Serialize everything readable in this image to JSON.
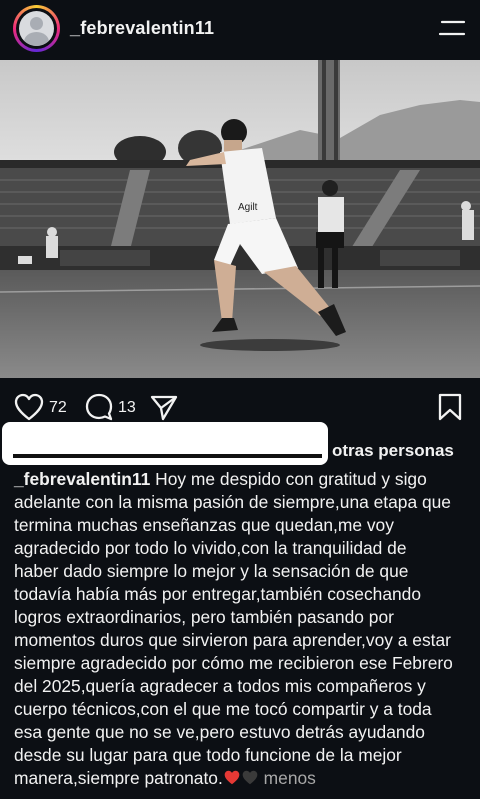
{
  "header": {
    "username": "_febrevalentin11",
    "avatar_icon": "default-avatar-icon",
    "menu_icon": "menu-icon"
  },
  "post": {
    "image_description_colors": {
      "sky": "#b9b9b9",
      "field": "#6e6e6e"
    },
    "player_jersey_text": "Agilt"
  },
  "actions": {
    "like_count": "72",
    "comment_count": "13",
    "icons": [
      "heart-icon",
      "comment-icon",
      "share-icon",
      "bookmark-icon"
    ]
  },
  "liked_by": {
    "others_text": "otras personas"
  },
  "caption": {
    "username": "_febrevalentin11",
    "lines": [
      " Hoy me despido con gratitud y sigo",
      "adelante con la misma pasión de siempre,una etapa que",
      "termina muchas enseñanzas que quedan,me voy",
      "agradecido por todo lo vivido,con la tranquilidad de",
      "haber dado siempre lo mejor y la sensación de que",
      "todavía había más por entregar,también cosechando",
      "logros extraordinarios, pero también pasando por",
      "momentos duros que sirvieron para aprender,voy a estar",
      "siempre agradecido por cómo me recibieron ese Febrero",
      "del 2025,quería agradecer a todos mis compañeros y",
      "cuerpo técnicos,con el que me tocó compartir y a toda",
      "esa gente que no se ve,pero estuvo detrás ayudando",
      "desde su lugar para que todo funcione de la mejor",
      "manera,siempre patronato."
    ],
    "less_label": "menos",
    "accent_colors": {
      "red_heart": "#e53935",
      "black_heart": "#3a3a3a"
    }
  }
}
